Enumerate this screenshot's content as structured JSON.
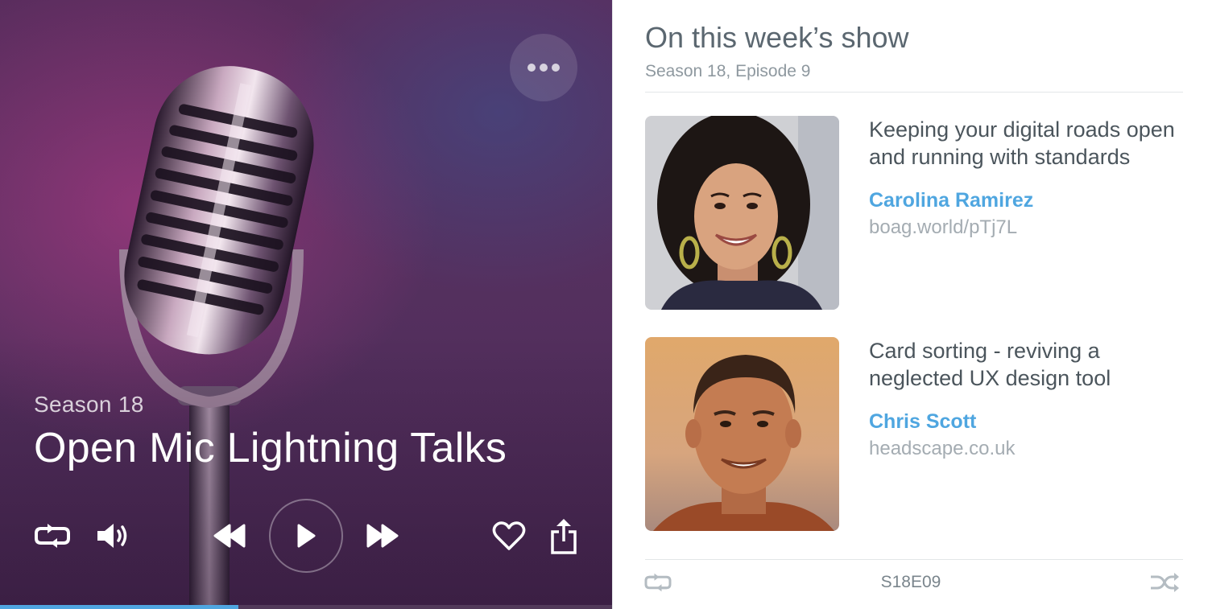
{
  "player": {
    "season_label": "Season 18",
    "episode_title": "Open Mic Lightning Talks",
    "progress_fraction": 0.39,
    "accent_color": "#4fa6e0",
    "controls": [
      {
        "name": "repeat",
        "icon": "repeat-icon"
      },
      {
        "name": "volume",
        "icon": "volume-icon"
      },
      {
        "name": "rewind",
        "icon": "rewind-icon"
      },
      {
        "name": "play",
        "icon": "play-icon"
      },
      {
        "name": "fast-forward",
        "icon": "fast-forward-icon"
      },
      {
        "name": "favorite",
        "icon": "heart-icon"
      },
      {
        "name": "share",
        "icon": "share-icon"
      },
      {
        "name": "more",
        "icon": "more-dots-icon"
      }
    ]
  },
  "show": {
    "heading": "On this week’s show",
    "subheading": "Season 18, Episode 9",
    "talks": [
      {
        "title": "Keeping your digital roads open and running with standards",
        "speaker": "Carolina Ramirez",
        "link": "boag.world/pTj7L"
      },
      {
        "title": "Card sorting - reviving a neglected UX design tool",
        "speaker": "Chris Scott",
        "link": "headscape.co.uk"
      }
    ],
    "footer": {
      "episode_code": "S18E09",
      "left_icon": "repeat-icon",
      "right_icon": "shuffle-icon"
    }
  }
}
